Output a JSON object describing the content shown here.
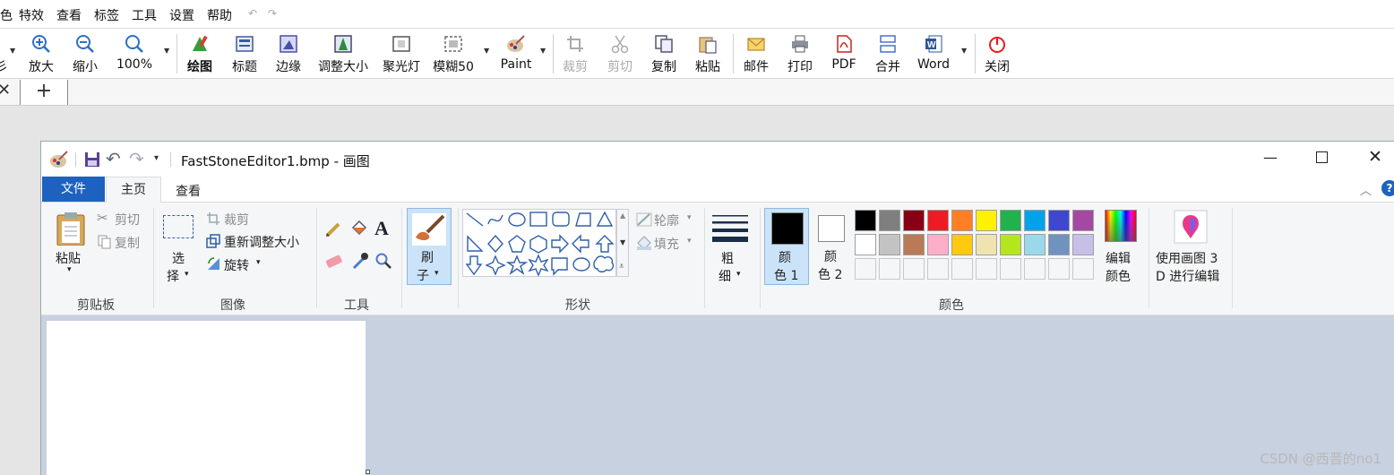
{
  "fastStone": {
    "menu": [
      "色",
      "特效",
      "查看",
      "标签",
      "工具",
      "设置",
      "帮助"
    ],
    "toolbar": [
      {
        "label": "彡",
        "icon": "shape-icon"
      },
      {
        "label": "放大",
        "icon": "zoom-in-icon"
      },
      {
        "label": "缩小",
        "icon": "zoom-out-icon"
      },
      {
        "label": "100%",
        "icon": "zoom-actual-icon"
      },
      {
        "label": "绘图",
        "icon": "draw-icon"
      },
      {
        "label": "标题",
        "icon": "caption-icon"
      },
      {
        "label": "边缘",
        "icon": "edge-icon"
      },
      {
        "label": "调整大小",
        "icon": "resize-icon"
      },
      {
        "label": "聚光灯",
        "icon": "spotlight-icon"
      },
      {
        "label": "模糊50",
        "icon": "blur-icon"
      },
      {
        "label": "Paint",
        "icon": "paint-icon"
      },
      {
        "label": "裁剪",
        "icon": "crop-icon"
      },
      {
        "label": "剪切",
        "icon": "cut-icon"
      },
      {
        "label": "复制",
        "icon": "copy-icon"
      },
      {
        "label": "粘贴",
        "icon": "paste-icon"
      },
      {
        "label": "邮件",
        "icon": "mail-icon"
      },
      {
        "label": "打印",
        "icon": "print-icon"
      },
      {
        "label": "PDF",
        "icon": "pdf-icon"
      },
      {
        "label": "合并",
        "icon": "merge-icon"
      },
      {
        "label": "Word",
        "icon": "word-icon"
      },
      {
        "label": "关闭",
        "icon": "power-icon"
      }
    ],
    "tab_new": "+",
    "tab_close": "✕"
  },
  "paint": {
    "title": "FastStoneEditor1.bmp - 画图",
    "tabs": {
      "file": "文件",
      "home": "主页",
      "view": "查看"
    },
    "clipboard": {
      "paste": "粘贴",
      "cut": "剪切",
      "copy": "复制",
      "label": "剪贴板"
    },
    "image": {
      "select_1": "选",
      "select_2": "择",
      "crop": "裁剪",
      "resize": "重新调整大小",
      "rotate": "旋转",
      "label": "图像"
    },
    "tools": {
      "label": "工具"
    },
    "brush": {
      "line1": "刷",
      "line2": "子"
    },
    "shapes": {
      "outline": "轮廓",
      "fill": "填充",
      "label": "形状"
    },
    "size": {
      "line1": "粗",
      "line2": "细"
    },
    "color1": {
      "line1": "颜",
      "line2": "色 1",
      "value": "#000000"
    },
    "color2": {
      "line1": "颜",
      "line2": "色 2",
      "value": "#ffffff"
    },
    "palette_row1": [
      "#000000",
      "#7f7f7f",
      "#880015",
      "#ed1c24",
      "#ff7f27",
      "#fff200",
      "#22b14c",
      "#00a2e8",
      "#3f48cc",
      "#a349a4"
    ],
    "palette_row2": [
      "#ffffff",
      "#c3c3c3",
      "#b97a57",
      "#ffaec9",
      "#ffc90e",
      "#efe4b0",
      "#b5e61d",
      "#99d9ea",
      "#7092be",
      "#c8bfe7"
    ],
    "palette_row3": [
      "#f5f6f7",
      "#f5f6f7",
      "#f5f6f7",
      "#f5f6f7",
      "#f5f6f7",
      "#f5f6f7",
      "#f5f6f7",
      "#f5f6f7",
      "#f5f6f7",
      "#f5f6f7"
    ],
    "edit_colors": {
      "line1": "编辑",
      "line2": "颜色"
    },
    "colors_label": "颜色",
    "paint3d": {
      "line1": "使用画图 3",
      "line2": "D 进行编辑"
    }
  },
  "watermark": "CSDN @西晋的no1"
}
